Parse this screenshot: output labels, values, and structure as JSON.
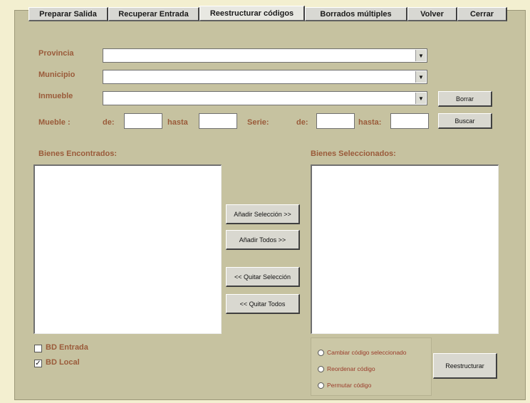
{
  "tabs": [
    {
      "label": "Preparar Salida"
    },
    {
      "label": "Recuperar Entrada"
    },
    {
      "label": "Reestructurar códigos"
    },
    {
      "label": "Borrados múltiples"
    },
    {
      "label": "Volver"
    },
    {
      "label": "Cerrar"
    }
  ],
  "filters": {
    "provincia_label": "Provincia",
    "municipio_label": "Municipio",
    "inmueble_label": "Inmueble",
    "mueble_label": "Mueble :",
    "de_label": "de:",
    "hasta_label": "hasta",
    "serie_label": "Serie:",
    "serie_de_label": "de:",
    "serie_hasta_label": "hasta:",
    "provincia_value": "",
    "municipio_value": "",
    "inmueble_value": "",
    "mueble_de_value": "",
    "mueble_hasta_value": "",
    "serie_de_value": "",
    "serie_hasta_value": ""
  },
  "buttons": {
    "borrar": "Borrar",
    "buscar": "Buscar",
    "add_selection": "Añadir Selección >>",
    "add_all": "Añadir Todos >>",
    "remove_selection": "<< Quitar Selección",
    "remove_all": "<< Quitar Todos",
    "restructure": "Reestructurar"
  },
  "lists": {
    "found_label": "Bienes Encontrados:",
    "selected_label": "Bienes Seleccionados:",
    "found_items": [],
    "selected_items": []
  },
  "databases": {
    "entrada_label": "BD Entrada",
    "entrada_checked": false,
    "local_label": "BD Local",
    "local_checked": true,
    "check_mark": "✓"
  },
  "options": {
    "items": [
      {
        "label": "Cambiar código seleccionado"
      },
      {
        "label": "Reordenar código"
      },
      {
        "label": "Permutar código"
      }
    ]
  },
  "colors": {
    "panel": "#c6c2a0",
    "label": "#9a5b3a",
    "background": "#f3efd0"
  }
}
